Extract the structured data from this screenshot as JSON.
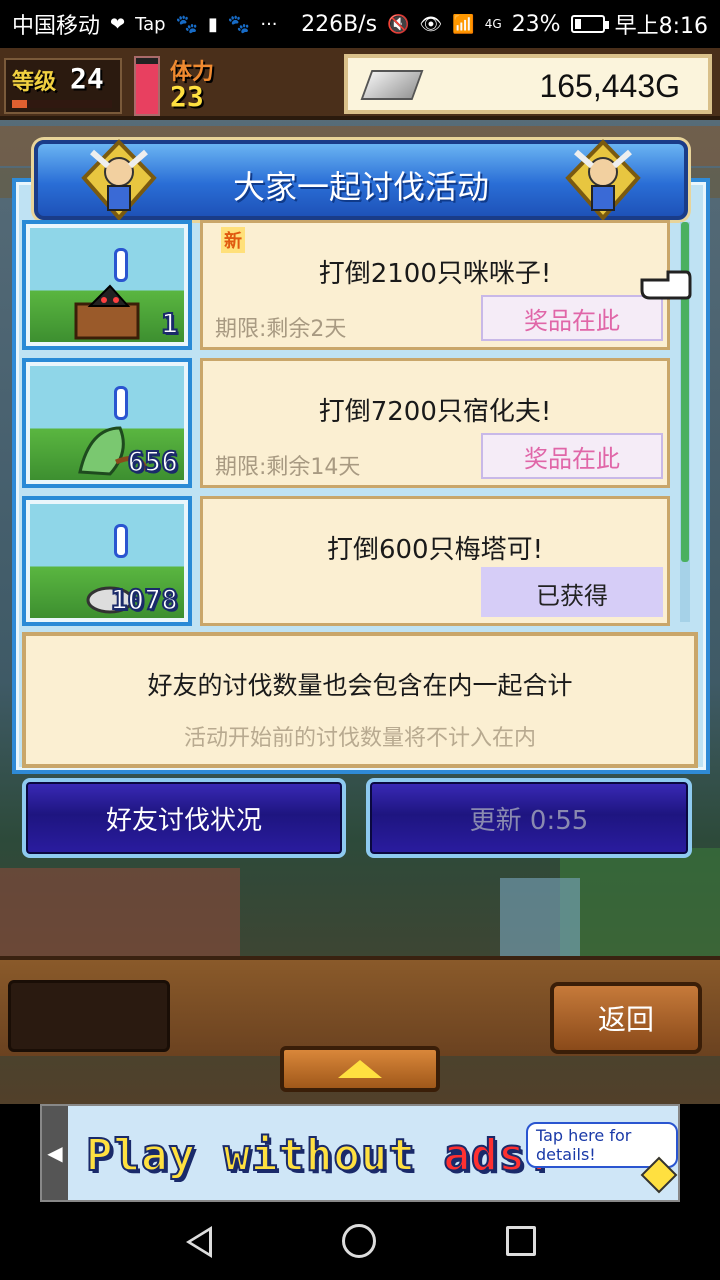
{
  "status_bar": {
    "carrier": "中国移动",
    "net_speed": "226B/s",
    "signal_label": "4G",
    "battery": "23%",
    "battery_fraction": 0.23,
    "time": "早上8:16"
  },
  "hud": {
    "level_label": "等级",
    "level": "24",
    "level_progress": 0.15,
    "stamina_label": "体力",
    "stamina": "23",
    "stamina_fraction": 0.9,
    "gold": "165,443G"
  },
  "event": {
    "title": "大家一起讨伐活动",
    "rows": [
      {
        "new_badge": "新",
        "count": "1",
        "title": "打倒2100只咪咪子!",
        "deadline": "期限:剩余2天",
        "action": "奖品在此",
        "state": "prize"
      },
      {
        "new_badge": "",
        "count": "656",
        "title": "打倒7200只宿化夫!",
        "deadline": "期限:剩余14天",
        "action": "奖品在此",
        "state": "prize"
      },
      {
        "new_badge": "",
        "count": "1078",
        "title": "打倒600只梅塔可!",
        "deadline": "",
        "action": "已获得",
        "state": "obtained"
      }
    ],
    "note_main": "好友的讨伐数量也会包含在内一起合计",
    "note_sub": "活动开始前的讨伐数量将不计入在内",
    "friends_button": "好友讨伐状况",
    "refresh_button": "更新 0:55"
  },
  "toolbar": {
    "back_label": "返回"
  },
  "ad": {
    "text_part1": "Play without ",
    "text_part2": "ads!",
    "bubble": "Tap here for details!"
  },
  "colors": {
    "panel_border": "#2f8ad6",
    "card_bg": "#fbefd2",
    "prize_text": "#e066a8",
    "obtained_bg": "#d6cdf7"
  }
}
